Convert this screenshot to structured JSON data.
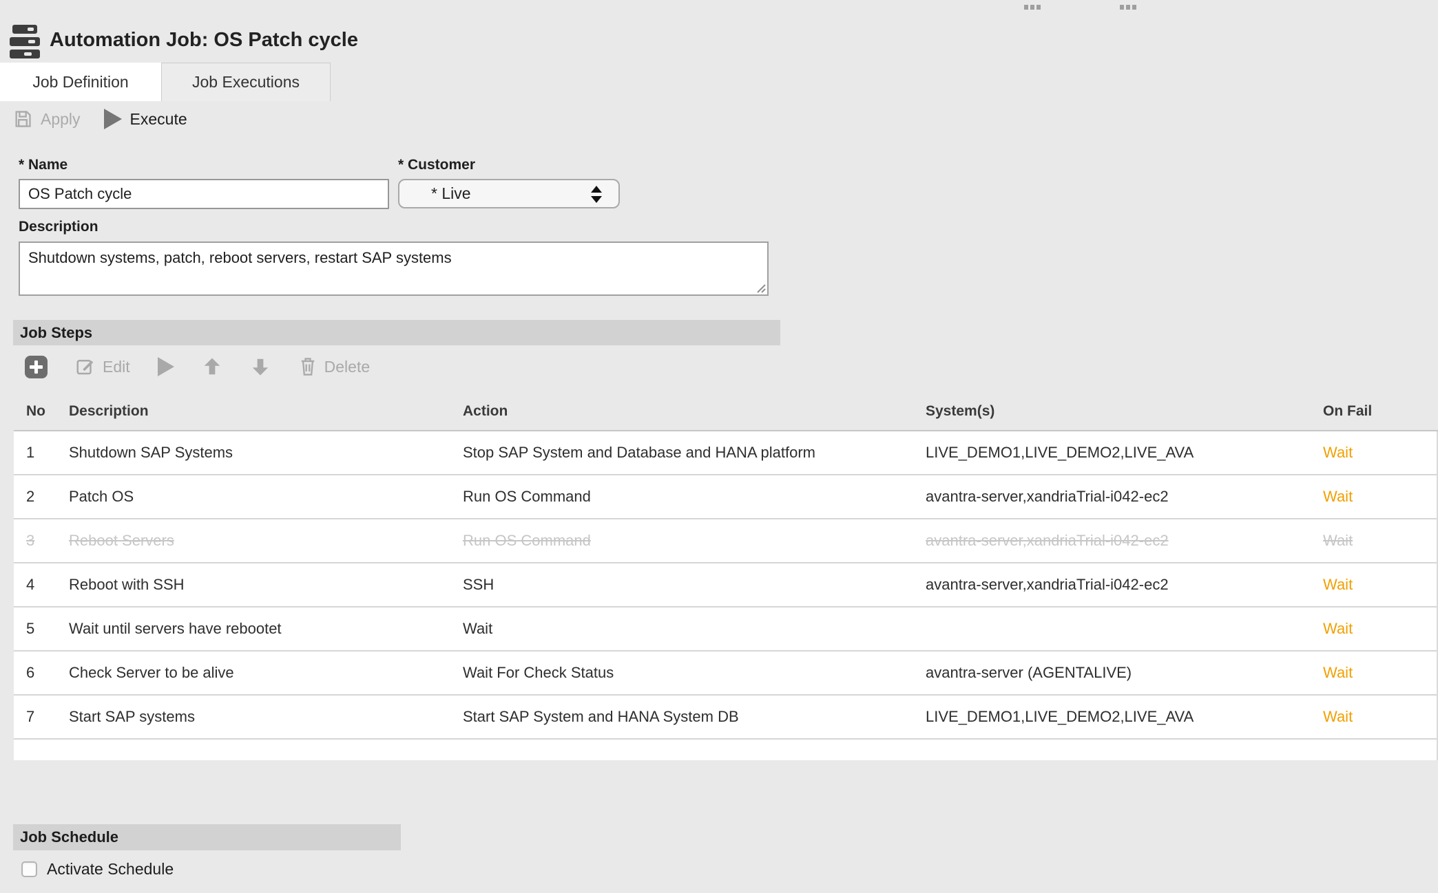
{
  "header": {
    "title": "Automation Job: OS Patch cycle"
  },
  "tabs": [
    {
      "label": "Job Definition",
      "active": true
    },
    {
      "label": "Job Executions",
      "active": false
    }
  ],
  "toolbar": {
    "apply_label": "Apply",
    "execute_label": "Execute"
  },
  "form": {
    "name_label": "* Name",
    "name_value": "OS Patch cycle",
    "customer_label": "* Customer",
    "customer_value": "* Live",
    "description_label": "Description",
    "description_value": "Shutdown systems, patch, reboot servers, restart SAP systems"
  },
  "job_steps": {
    "section_title": "Job Steps",
    "toolbar": {
      "edit_label": "Edit",
      "delete_label": "Delete"
    },
    "columns": [
      "No",
      "Description",
      "Action",
      "System(s)",
      "On Fail"
    ],
    "rows": [
      {
        "no": "1",
        "description": "Shutdown SAP Systems",
        "action": "Stop SAP System and Database and HANA platform",
        "systems": "LIVE_DEMO1,LIVE_DEMO2,LIVE_AVA",
        "on_fail": "Wait",
        "disabled": false
      },
      {
        "no": "2",
        "description": "Patch OS",
        "action": "Run OS Command",
        "systems": "avantra-server,xandriaTrial-i042-ec2",
        "on_fail": "Wait",
        "disabled": false
      },
      {
        "no": "3",
        "description": "Reboot Servers",
        "action": "Run OS Command",
        "systems": "avantra-server,xandriaTrial-i042-ec2",
        "on_fail": "Wait",
        "disabled": true
      },
      {
        "no": "4",
        "description": "Reboot with SSH",
        "action": "SSH",
        "systems": "avantra-server,xandriaTrial-i042-ec2",
        "on_fail": "Wait",
        "disabled": false
      },
      {
        "no": "5",
        "description": "Wait until servers have rebootet",
        "action": "Wait",
        "systems": "",
        "on_fail": "Wait",
        "disabled": false
      },
      {
        "no": "6",
        "description": "Check Server to be alive",
        "action": "Wait For Check Status",
        "systems": "avantra-server (AGENTALIVE)",
        "on_fail": "Wait",
        "disabled": false
      },
      {
        "no": "7",
        "description": "Start SAP systems",
        "action": "Start SAP System and HANA System DB",
        "systems": "LIVE_DEMO1,LIVE_DEMO2,LIVE_AVA",
        "on_fail": "Wait",
        "disabled": false
      }
    ]
  },
  "job_schedule": {
    "section_title": "Job Schedule",
    "activate_label": "Activate Schedule",
    "activated": false
  },
  "icons": {
    "app": "server-stack",
    "apply": "floppy-disk",
    "execute": "play-triangle",
    "add": "plus",
    "edit": "pencil-square",
    "run": "play-triangle",
    "move_up": "arrow-up",
    "move_down": "arrow-down",
    "delete": "trash"
  },
  "colors": {
    "on_fail": "#F0A000",
    "section_bar": "#d2d2d2",
    "page_background": "#e9e9e9"
  }
}
